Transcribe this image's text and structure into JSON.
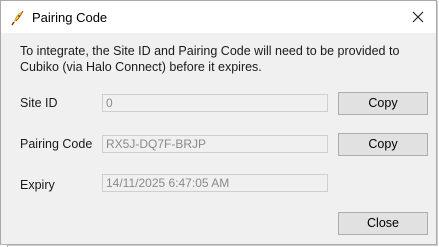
{
  "window": {
    "title": "Pairing Code",
    "close_glyph": "✕",
    "app_icon": "feather-quill-icon"
  },
  "description": "To integrate, the Site ID and Pairing Code will need to be provided to Cubiko (via Halo Connect) before it expires.",
  "fields": {
    "site_id": {
      "label": "Site ID",
      "value": "0"
    },
    "pairing_code": {
      "label": "Pairing Code",
      "value": "RX5J-DQ7F-BRJP"
    },
    "expiry": {
      "label": "Expiry",
      "value": "14/11/2025 6:47:05 AM"
    }
  },
  "buttons": {
    "copy_site_id": "Copy",
    "copy_pairing_code": "Copy",
    "close": "Close"
  },
  "colors": {
    "window_bg": "#f0f0f0",
    "titlebar_bg": "#ffffff",
    "button_bg": "#e1e1e1",
    "button_border": "#adadad",
    "field_text": "#8a8a8a"
  }
}
